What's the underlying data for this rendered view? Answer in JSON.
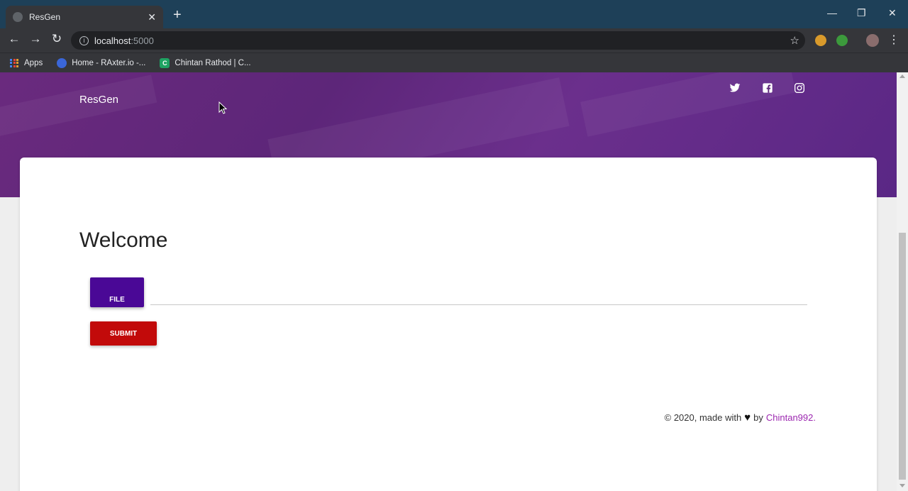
{
  "browser": {
    "tab_title": "ResGen",
    "tab_close": "✕",
    "new_tab": "+",
    "url_host": "localhost",
    "url_port": ":5000",
    "window_minimize": "—",
    "window_restore": "❐",
    "window_close": "✕",
    "bookmarks": [
      {
        "label": "Apps",
        "icon": "apps-grid-icon"
      },
      {
        "label": "Home - RAxter.io -...",
        "icon": "raxter-icon"
      },
      {
        "label": "Chintan Rathod | C...",
        "icon": "c-icon",
        "icon_letter": "C"
      }
    ]
  },
  "page": {
    "brand": "ResGen",
    "social": [
      "twitter-icon",
      "facebook-icon",
      "instagram-icon"
    ],
    "welcome": "Welcome",
    "file_button": "FILE",
    "submit_button": "SUBMIT",
    "footer": {
      "prefix": "© 2020, made with",
      "heart": "♥",
      "by": "by",
      "author": "Chintan992."
    }
  },
  "colors": {
    "hero": "#5d2679",
    "file_button": "#4a0896",
    "submit_button": "#c20a0a",
    "author_link": "#9c27b0"
  }
}
